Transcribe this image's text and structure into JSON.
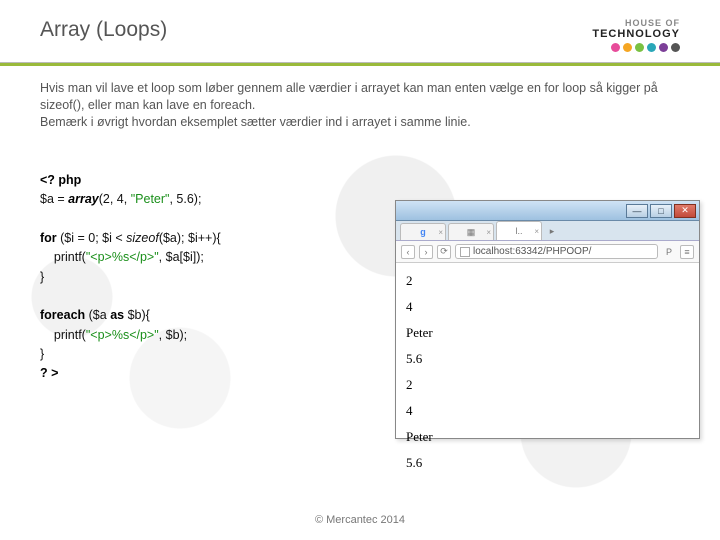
{
  "header": {
    "title": "Array (Loops)",
    "logo_line1": "HOUSE OF",
    "logo_line2": "TECHNOLOGY",
    "dot_colors": [
      "#e74c9a",
      "#f5a623",
      "#7ac142",
      "#2aa7b8",
      "#7c3f98",
      "#555555"
    ]
  },
  "paragraph": {
    "l1": "Hvis man vil lave et loop som løber gennem alle værdier i arrayet kan man enten vælge en for loop så kigger på sizeof(), eller man kan lave en foreach.",
    "l2": "Bemærk i øvrigt hvordan eksemplet sætter værdier ind i arrayet i samme linie."
  },
  "code": {
    "open_tag": "<? php",
    "assign_pre": "$a = ",
    "array_kw": "array",
    "assign_args_open": "(2, 4, ",
    "assign_str": "\"Peter\"",
    "assign_args_close": ", 5.6);",
    "for_kw": "for ",
    "for_cond_open": "($i = 0; $i < ",
    "sizeof_kw": "sizeof",
    "for_cond_close": "($a); $i++){",
    "printf1_pre": "    printf(",
    "printf1_str": "\"<p>%s</p>\"",
    "printf1_post": ", $a[$i]);",
    "close_brace1": "}",
    "foreach_kw": "foreach ",
    "foreach_cond_open": "($a ",
    "as_kw": "as",
    "foreach_cond_close": " $b){",
    "printf2_pre": "    printf(",
    "printf2_str": "\"<p>%s</p>\"",
    "printf2_post": ", $b);",
    "close_brace2": "}",
    "close_tag": "? >"
  },
  "browser": {
    "tabs": [
      {
        "label": "",
        "icon": "g"
      },
      {
        "label": "",
        "icon": "p"
      },
      {
        "label": "",
        "icon": "l",
        "active": true
      }
    ],
    "address": "localhost:63342/PHPOOP/",
    "nav_back": "‹",
    "nav_fwd": "›",
    "reload": "⟳",
    "menu": "≡",
    "win_min": "—",
    "win_max": "□",
    "win_close": "✕",
    "output": [
      "2",
      "4",
      "Peter",
      "5.6",
      "2",
      "4",
      "Peter",
      "5.6"
    ]
  },
  "footer": "© Mercantec 2014"
}
